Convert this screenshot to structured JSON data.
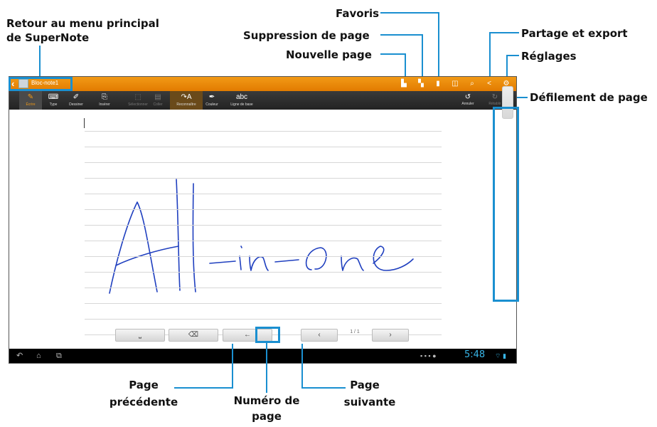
{
  "callouts": {
    "back_line1": "Retour au menu principal",
    "back_line2": "de SuperNote",
    "favorites": "Favoris",
    "delete_page": "Suppression de page",
    "new_page": "Nouvelle page",
    "share_export": "Partage et export",
    "settings": "Réglages",
    "page_scroll": "Défilement de page",
    "prev_page_line1": "Page",
    "prev_page_line2": "précédente",
    "page_number_line1": "Numéro de",
    "page_number_line2": "page",
    "next_page_line1": "Page",
    "next_page_line2": "suivante"
  },
  "app": {
    "notebook_title": "Bloc-note1",
    "toolbar": [
      {
        "label": "Écrire",
        "icon": "pen-icon",
        "glyph": "✎",
        "state": "active"
      },
      {
        "label": "Type",
        "icon": "keyboard-icon",
        "glyph": "⌨",
        "state": "normal"
      },
      {
        "label": "Dessiner",
        "icon": "brush-icon",
        "glyph": "✐",
        "state": "normal"
      },
      {
        "label": "Insérer",
        "icon": "insert-icon",
        "glyph": "⎘",
        "state": "normal"
      },
      {
        "label": "Sélectionner",
        "icon": "select-icon",
        "glyph": "⬚",
        "state": "disabled"
      },
      {
        "label": "Coller",
        "icon": "paste-icon",
        "glyph": "▤",
        "state": "disabled"
      },
      {
        "label": "Reconnaître",
        "icon": "recognize-icon",
        "glyph": "↷A",
        "state": "highlight"
      },
      {
        "label": "Couleur",
        "icon": "color-icon",
        "glyph": "✒",
        "state": "normal"
      },
      {
        "label": "Ligne de base",
        "icon": "baseline-icon",
        "glyph": "abc",
        "state": "normal"
      }
    ],
    "undo_label": "Annuler",
    "redo_label": "Rétablir",
    "handwriting": "All-in-one",
    "page_indicator": "1 / 1",
    "clock": "5:48"
  },
  "colors": {
    "accent": "#1a8fd0",
    "title_bar": "#e88a0c",
    "ink": "#1f3fbf"
  }
}
